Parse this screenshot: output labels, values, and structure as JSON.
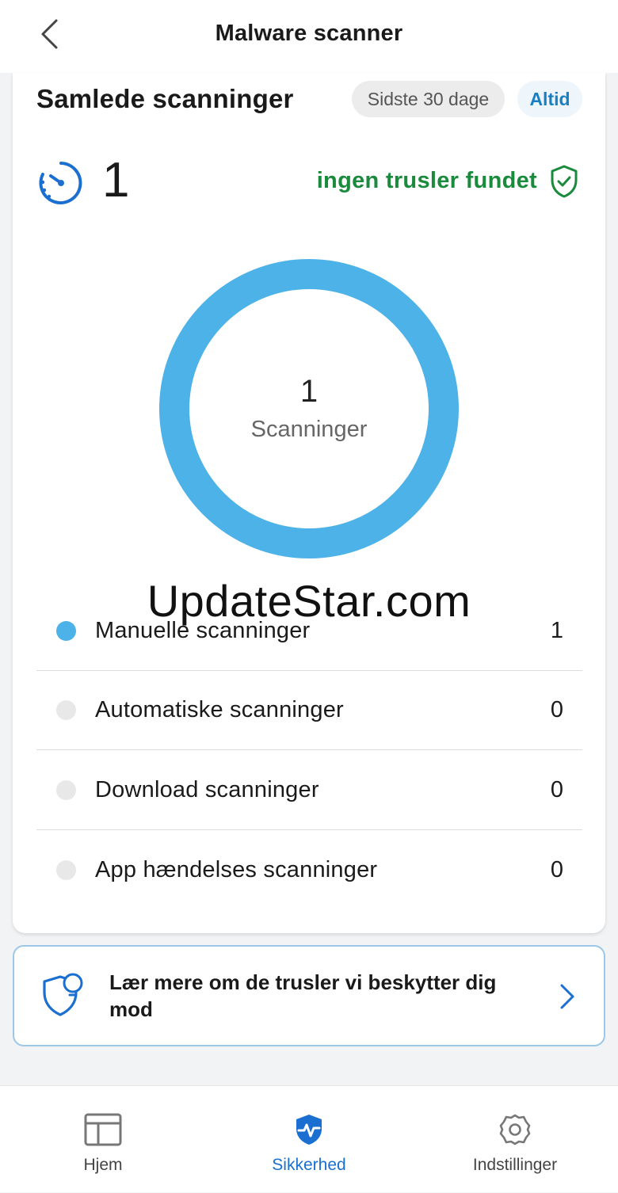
{
  "header": {
    "title": "Malware scanner",
    "back_icon": "chevron-left-icon"
  },
  "summary": {
    "title": "Samlede scanninger",
    "filters": {
      "last30": "Sidste 30 dage",
      "always": "Altid",
      "selected": "Altid"
    },
    "total": "1",
    "status": "ingen trusler fundet",
    "status_color": "#1a8a3c"
  },
  "donut": {
    "value": "1",
    "label": "Scanninger"
  },
  "watermark": "UpdateStar.com",
  "breakdown": [
    {
      "label": "Manuelle scanninger",
      "value": "1",
      "color": "#4db2e8"
    },
    {
      "label": "Automatiske scanninger",
      "value": "0",
      "color": "#e8e8e8"
    },
    {
      "label": "Download scanninger",
      "value": "0",
      "color": "#e8e8e8"
    },
    {
      "label": "App hændelses scanninger",
      "value": "0",
      "color": "#e8e8e8"
    }
  ],
  "learn": {
    "text": "Lær mere om de trusler vi beskytter dig mod"
  },
  "tabs": [
    {
      "label": "Hjem",
      "icon": "layout-icon",
      "active": false
    },
    {
      "label": "Sikkerhed",
      "icon": "shield-pulse-icon",
      "active": true
    },
    {
      "label": "Indstillinger",
      "icon": "gear-icon",
      "active": false
    }
  ],
  "colors": {
    "accent": "#1a6fd1",
    "donut": "#4db2e8",
    "ok": "#1a8a3c"
  }
}
